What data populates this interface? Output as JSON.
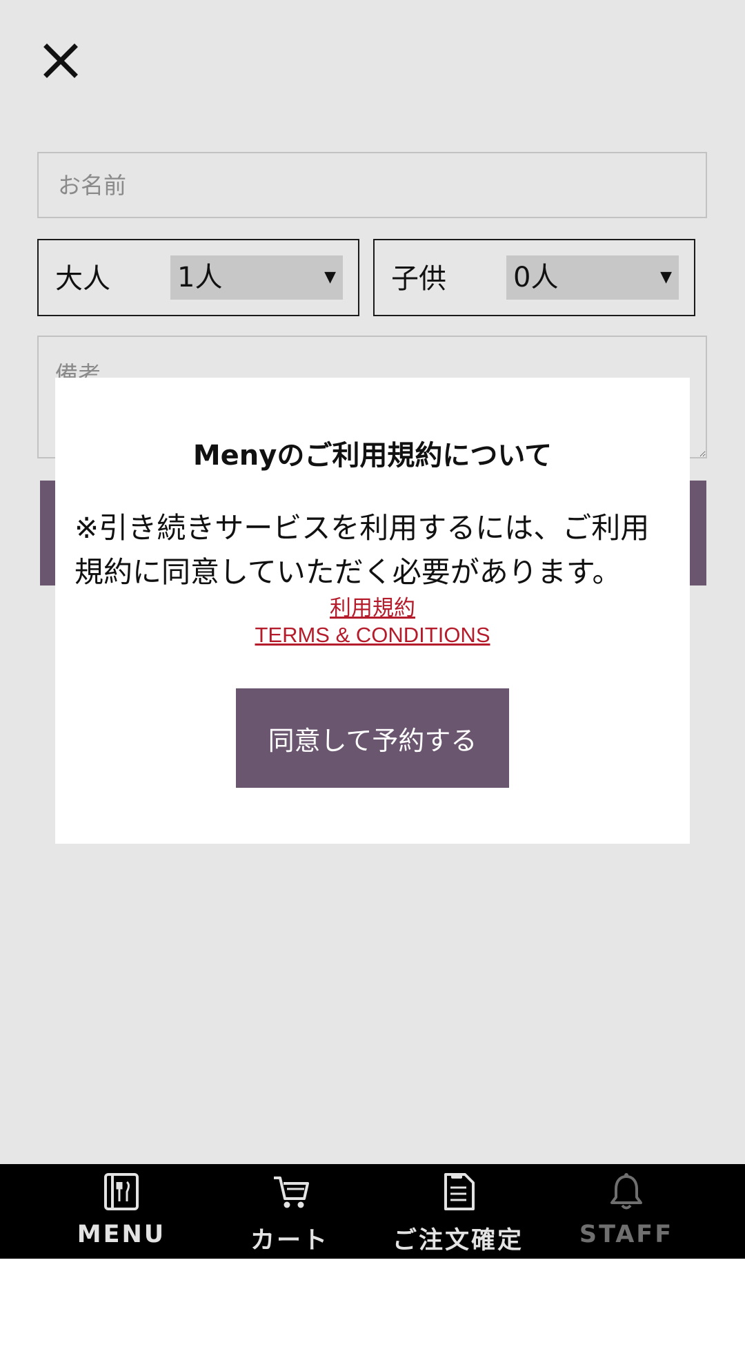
{
  "form": {
    "name_placeholder": "お名前",
    "adults": {
      "label": "大人",
      "selected": "1人"
    },
    "children": {
      "label": "子供",
      "selected": "0人"
    },
    "remarks_placeholder": "備考"
  },
  "icons": {
    "close": "close-icon",
    "dropdown": "triangle-down-icon",
    "menu": "menu-book-icon",
    "cart": "cart-icon",
    "order": "order-document-icon",
    "staff": "bell-icon"
  },
  "modal": {
    "title": "Menyのご利用規約について",
    "message": "※引き続きサービスを利用するには、ご利用規約に同意していただく必要があります。",
    "terms_link_ja": "利用規約",
    "terms_link_en": "TERMS & CONDITIONS",
    "agree_button": "同意して予約する"
  },
  "bottom_nav": {
    "menu": "MENU",
    "cart": "カート",
    "order_confirm": "ご注文確定",
    "staff": "STAFF"
  },
  "colors": {
    "accent_purple": "#6b5670",
    "link_red": "#b51c2b",
    "app_background": "#e6e6e6",
    "nav_background": "#000000"
  }
}
